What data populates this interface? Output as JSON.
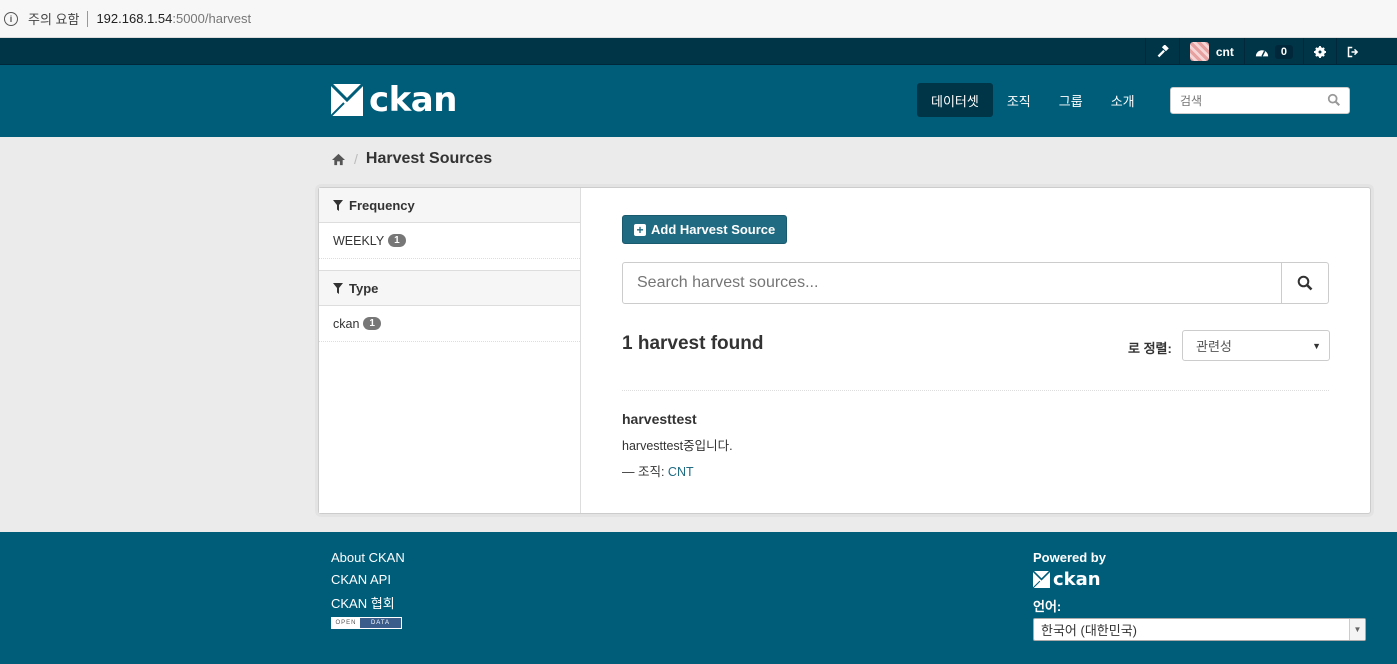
{
  "browser": {
    "security_warning": "주의 요함",
    "url_host": "192.168.1.54",
    "url_path": ":5000/harvest"
  },
  "account": {
    "username": "cnt",
    "dashboard_count": "0",
    "icons": [
      "hammer-icon",
      "dashboard-icon",
      "gear-icon",
      "sign-out-icon"
    ]
  },
  "masthead": {
    "logo_text": "ckan",
    "nav": [
      "데이터셋",
      "조직",
      "그룹",
      "소개"
    ],
    "active_nav": "데이터셋",
    "search_placeholder": "검색"
  },
  "breadcrumb": {
    "home_icon": "home-icon",
    "title": "Harvest Sources"
  },
  "facets": [
    {
      "title": "Frequency",
      "items": [
        {
          "label": "WEEKLY",
          "count": "1"
        }
      ]
    },
    {
      "title": "Type",
      "items": [
        {
          "label": "ckan",
          "count": "1"
        }
      ]
    }
  ],
  "main": {
    "add_button": "Add Harvest Source",
    "search_placeholder": "Search harvest sources...",
    "found_text": "1 harvest found",
    "order_label": "로 정렬:",
    "order_selected": "관련성",
    "results": [
      {
        "title": "harvesttest",
        "description": "harvesttest중입니다.",
        "org_prefix": "— 조직: ",
        "org_name": "CNT"
      }
    ]
  },
  "footer": {
    "links": [
      "About CKAN",
      "CKAN API",
      "CKAN 협회"
    ],
    "open_data_left": "OPEN",
    "open_data_right": "DATA",
    "powered_by": "Powered by",
    "logo_text": "ckan",
    "language_label": "언어:",
    "language_selected": "한국어 (대한민국)"
  },
  "colors": {
    "masthead": "#005d7a",
    "account_bar": "#003547",
    "accent_button": "#206b82"
  }
}
